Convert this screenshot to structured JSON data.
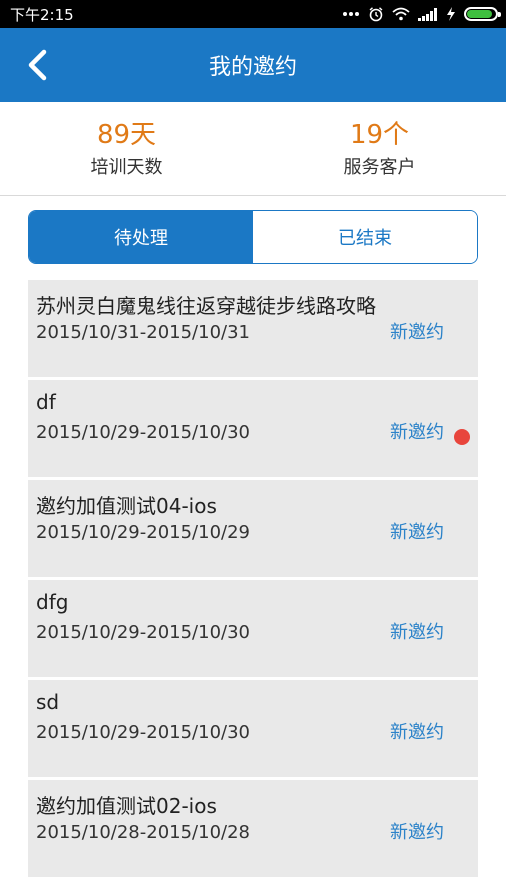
{
  "statusbar": {
    "time": "下午2:15",
    "icons": [
      "more-dots-icon",
      "alarm-icon",
      "wifi-icon",
      "signal-icon",
      "charging-icon",
      "battery-icon"
    ],
    "battery_level": 0.9
  },
  "header": {
    "title": "我的邀约",
    "back_icon": "chevron-left-icon"
  },
  "stats": [
    {
      "value": "89天",
      "label": "培训天数"
    },
    {
      "value": "19个",
      "label": "服务客户"
    }
  ],
  "tabs": [
    {
      "label": "待处理",
      "active": true
    },
    {
      "label": "已结束",
      "active": false
    }
  ],
  "invitations": [
    {
      "name": "苏州灵白魔鬼线往返穿越徒步线路攻略",
      "dates": "2015/10/31-2015/10/31",
      "status": "新邀约",
      "unread": false
    },
    {
      "name": "df",
      "dates": "2015/10/29-2015/10/30",
      "status": "新邀约",
      "unread": true
    },
    {
      "name": "邀约加值测试04-ios",
      "dates": "2015/10/29-2015/10/29",
      "status": "新邀约",
      "unread": false
    },
    {
      "name": "dfg",
      "dates": "2015/10/29-2015/10/30",
      "status": "新邀约",
      "unread": false
    },
    {
      "name": "sd",
      "dates": "2015/10/29-2015/10/30",
      "status": "新邀约",
      "unread": false
    },
    {
      "name": "邀约加值测试02-ios",
      "dates": "2015/10/28-2015/10/28",
      "status": "新邀约",
      "unread": false
    }
  ],
  "colors": {
    "primary": "#1b78c5",
    "accent": "#e07a17",
    "unread_dot": "#e8453c",
    "item_bg": "#e9e9e9"
  }
}
